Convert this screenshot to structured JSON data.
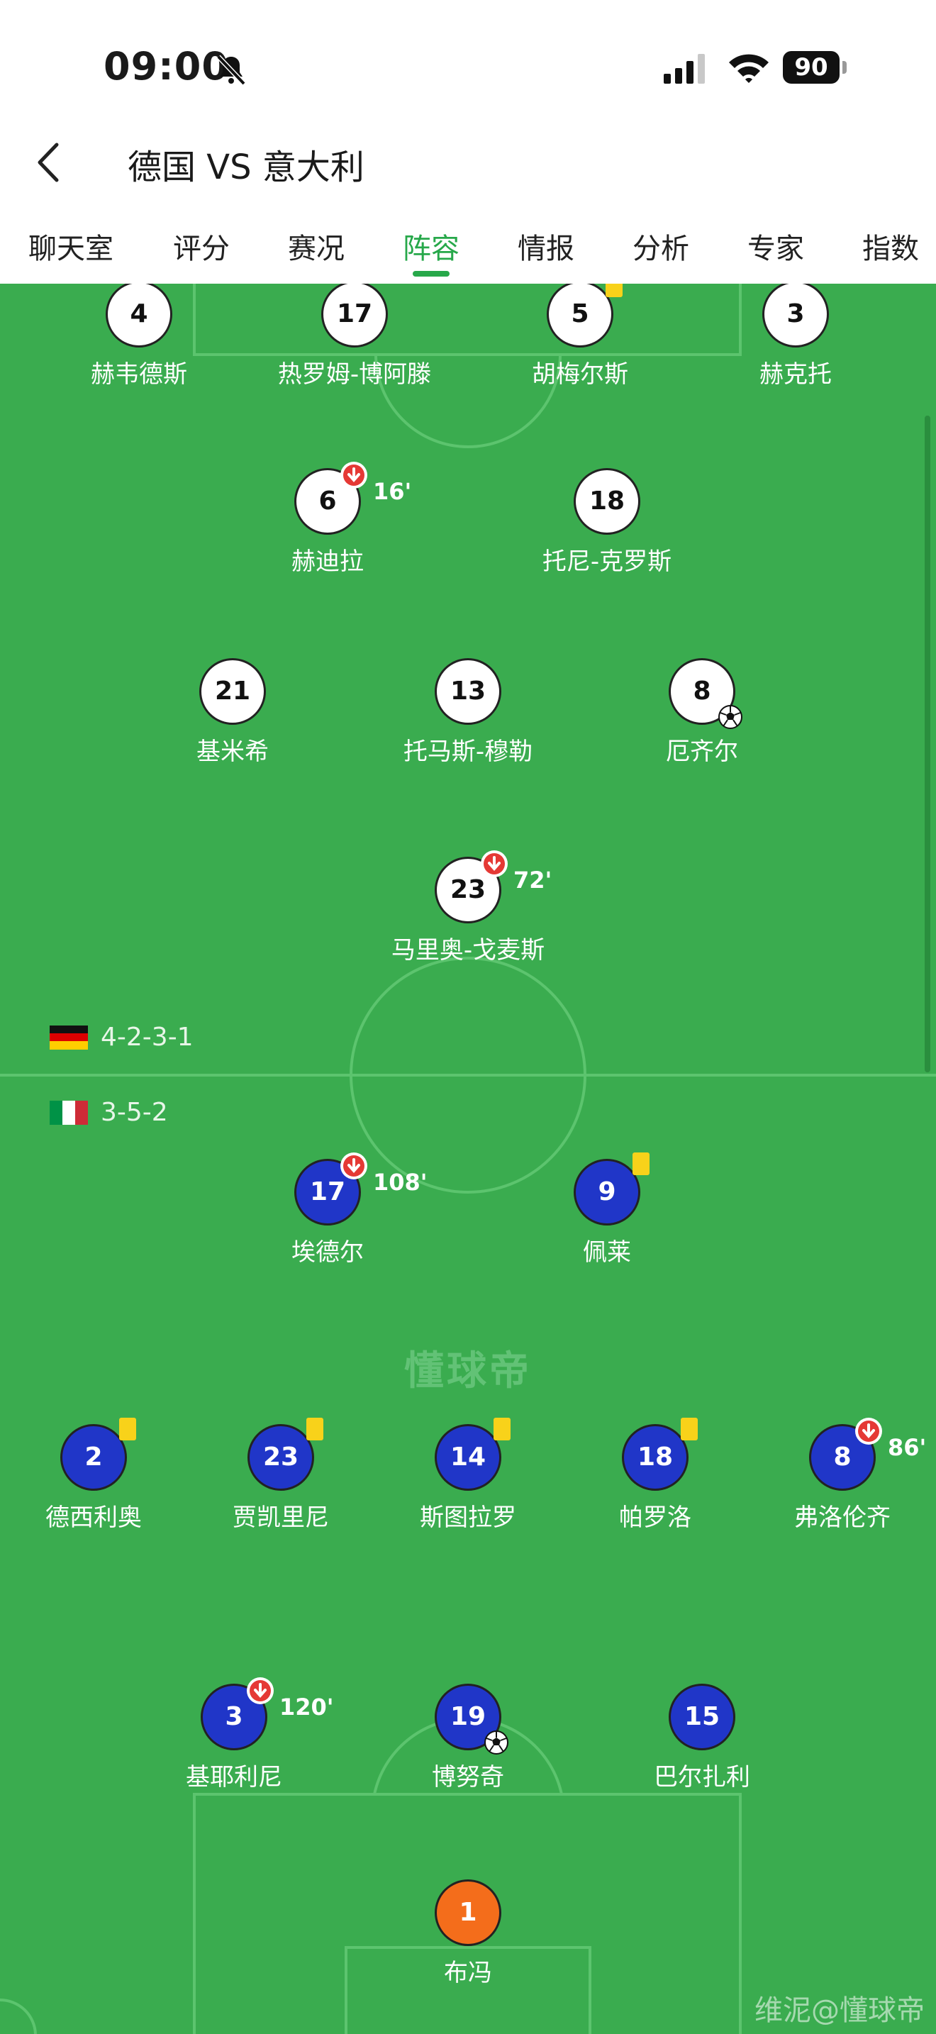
{
  "status_bar": {
    "time": "09:00",
    "battery": "90"
  },
  "nav": {
    "title": "德国 VS 意大利"
  },
  "tabs": [
    {
      "label": "聊天室",
      "active": false
    },
    {
      "label": "评分",
      "active": false
    },
    {
      "label": "赛况",
      "active": false
    },
    {
      "label": "阵容",
      "active": true
    },
    {
      "label": "情报",
      "active": false
    },
    {
      "label": "分析",
      "active": false
    },
    {
      "label": "专家",
      "active": false
    },
    {
      "label": "指数",
      "active": false
    }
  ],
  "germany": {
    "formation": "4-2-3-1",
    "players": [
      {
        "number": "4",
        "name": "赫韦德斯"
      },
      {
        "number": "17",
        "name": "热罗姆-博阿滕"
      },
      {
        "number": "5",
        "name": "胡梅尔斯",
        "yellow_card": true
      },
      {
        "number": "3",
        "name": "赫克托"
      },
      {
        "number": "6",
        "name": "赫迪拉",
        "sub_time": "16'"
      },
      {
        "number": "18",
        "name": "托尼-克罗斯"
      },
      {
        "number": "21",
        "name": "基米希"
      },
      {
        "number": "13",
        "name": "托马斯-穆勒"
      },
      {
        "number": "8",
        "name": "厄齐尔",
        "goal": true
      },
      {
        "number": "23",
        "name": "马里奥-戈麦斯",
        "sub_time": "72'"
      }
    ]
  },
  "italy": {
    "formation": "3-5-2",
    "players": [
      {
        "number": "17",
        "name": "埃德尔",
        "sub_time": "108'"
      },
      {
        "number": "9",
        "name": "佩莱",
        "yellow_card": true
      },
      {
        "number": "2",
        "name": "德西利奥",
        "yellow_card": true
      },
      {
        "number": "23",
        "name": "贾凯里尼",
        "yellow_card": true
      },
      {
        "number": "14",
        "name": "斯图拉罗",
        "yellow_card": true
      },
      {
        "number": "18",
        "name": "帕罗洛",
        "yellow_card": true
      },
      {
        "number": "8",
        "name": "弗洛伦齐",
        "sub_time": "86'"
      },
      {
        "number": "3",
        "name": "基耶利尼",
        "sub_time": "120'"
      },
      {
        "number": "19",
        "name": "博努奇",
        "goal": true
      },
      {
        "number": "15",
        "name": "巴尔扎利"
      },
      {
        "number": "1",
        "name": "布冯"
      }
    ]
  },
  "brand": "懂球帝",
  "watermark": "维泥@懂球帝",
  "colors": {
    "pitch": "#3aac4f",
    "accent": "#27a84a",
    "italy_kit": "#2036c8",
    "germany_kit": "#ffffff",
    "keeper_kit": "#f46d1b",
    "yellow_card": "#f8d21a",
    "sub_arrow": "#e53935"
  }
}
